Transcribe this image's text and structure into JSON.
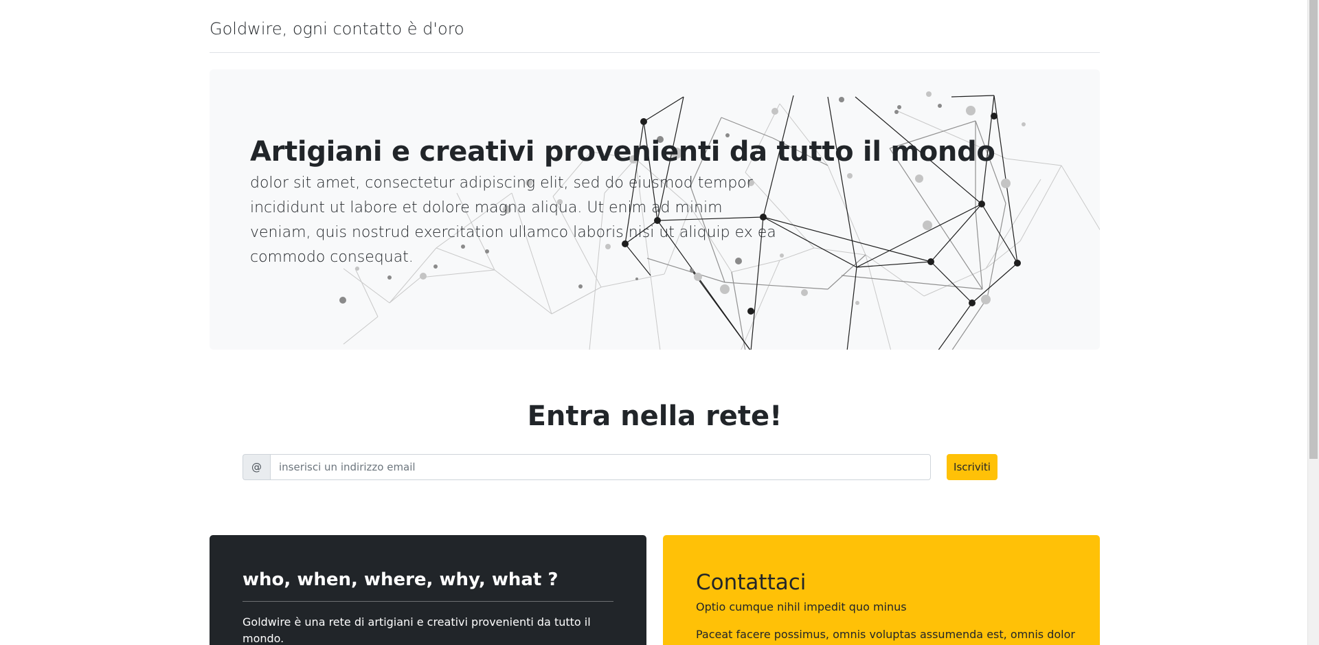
{
  "brand": {
    "name": "Goldwire, ogni contatto è d'oro"
  },
  "hero": {
    "title": "Artigiani e creativi provenienti da tutto il mondo",
    "lead": "dolor sit amet, consectetur adipiscing elit, sed do eiusmod tempor incididunt ut labore et dolore magna aliqua. Ut enim ad minim veniam, quis nostrud exercitation ullamco laboris nisi ut aliquip ex ea commodo consequat."
  },
  "signup": {
    "title": "Entra nella rete!",
    "prefix": "@",
    "placeholder": "inserisci un indirizzo email",
    "button_label": "Iscriviti"
  },
  "cards": {
    "about": {
      "title": "who, when, where, why, what ?",
      "text": "Goldwire è una rete di artigiani e creativi provenienti da tutto il mondo."
    },
    "contact": {
      "title": "Contattaci",
      "subtitle": "Optio cumque nihil impedit quo minus",
      "text": "Paceat facere possimus, omnis voluptas assumenda est, omnis dolor"
    }
  },
  "colors": {
    "accent": "#ffc107",
    "dark": "#212529",
    "hero_bg": "#f8f9fa"
  }
}
